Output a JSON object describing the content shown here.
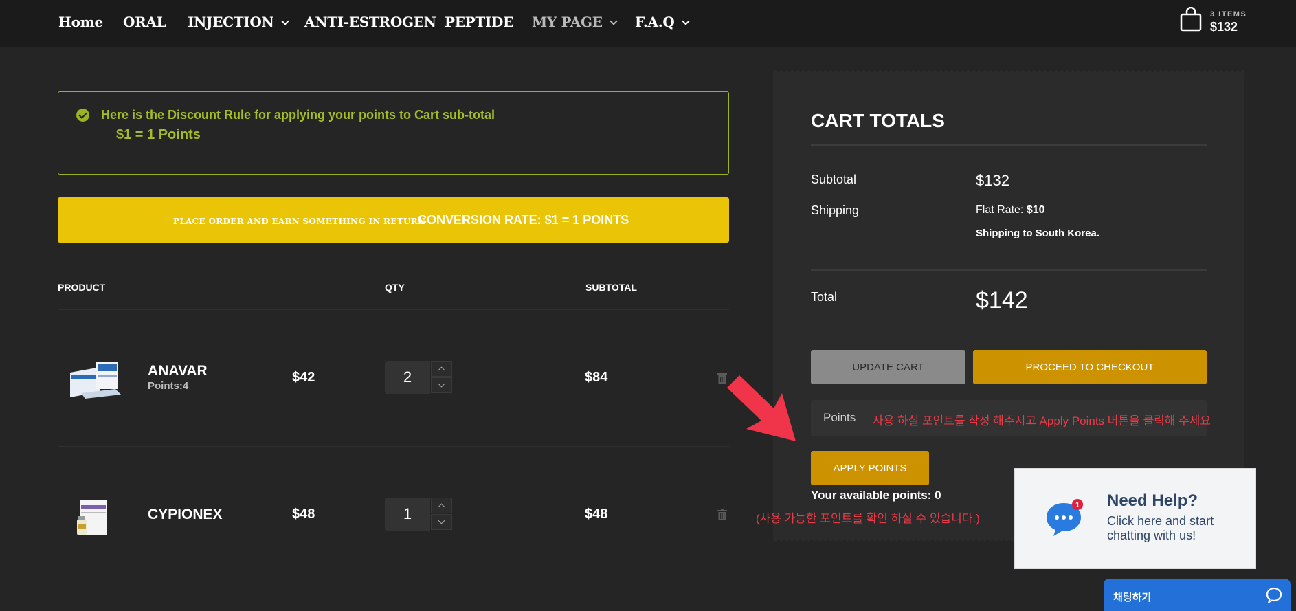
{
  "nav": {
    "items": [
      {
        "label": "Home",
        "dropdown": false
      },
      {
        "label": "ORAL",
        "dropdown": false
      },
      {
        "label": "INJECTION",
        "dropdown": true
      },
      {
        "label": "ANTI-ESTROGEN",
        "dropdown": false
      },
      {
        "label": "PEPTIDE",
        "dropdown": false
      },
      {
        "label": "MY PAGE",
        "dropdown": true
      },
      {
        "label": "F.A.Q",
        "dropdown": true
      }
    ],
    "cart": {
      "count_label": "3 ITEMS",
      "total": "$132",
      "icon": "shopping-bag-icon"
    }
  },
  "notice": {
    "line1": "Here is the Discount Rule for applying your points to Cart sub-total",
    "line2": "$1 = 1 Points",
    "color": "#9ab321"
  },
  "banner": {
    "small_text": "PLACE ORDER AND EARN SOMETHING IN RETURN",
    "big_text": "CONVERSION RATE: $1 = 1 POINTS",
    "color": "#eac407"
  },
  "table": {
    "headers": {
      "product": "PRODUCT",
      "qty": "QTY",
      "subtotal": "SUBTOTAL"
    },
    "rows": [
      {
        "name": "ANAVAR",
        "points": "Points:4",
        "price": "$42",
        "qty": "2",
        "subtotal": "$84"
      },
      {
        "name": "CYPIONEX",
        "points": "",
        "price": "$48",
        "qty": "1",
        "subtotal": "$48"
      }
    ]
  },
  "totals": {
    "title": "CART TOTALS",
    "subtotal_label": "Subtotal",
    "subtotal_value": "$132",
    "shipping_label": "Shipping",
    "shipping_rate_prefix": "Flat Rate: ",
    "shipping_rate_value": "$10",
    "shipping_to": "Shipping to South Korea.",
    "total_label": "Total",
    "total_value": "$142",
    "update_button": "UPDATE CART",
    "checkout_button": "PROCEED TO CHECKOUT",
    "points_placeholder": "Points",
    "points_note": "사용 하실 포인트를 작성 해주시고 Apply Points 버튼을 클릭해 주세요",
    "apply_button": "APPLY POINTS",
    "available": "Your available points: 0",
    "available_note": "(사용 가능한 포인트를 확인 하실 수 있습니다.)",
    "accent": "#cc9200",
    "note_color": "#e83a47"
  },
  "help": {
    "badge": "1",
    "title": "Need Help?",
    "subtitle": "Click here and start chatting with us!",
    "chat_label": "채팅하기",
    "accent": "#2270d8"
  }
}
